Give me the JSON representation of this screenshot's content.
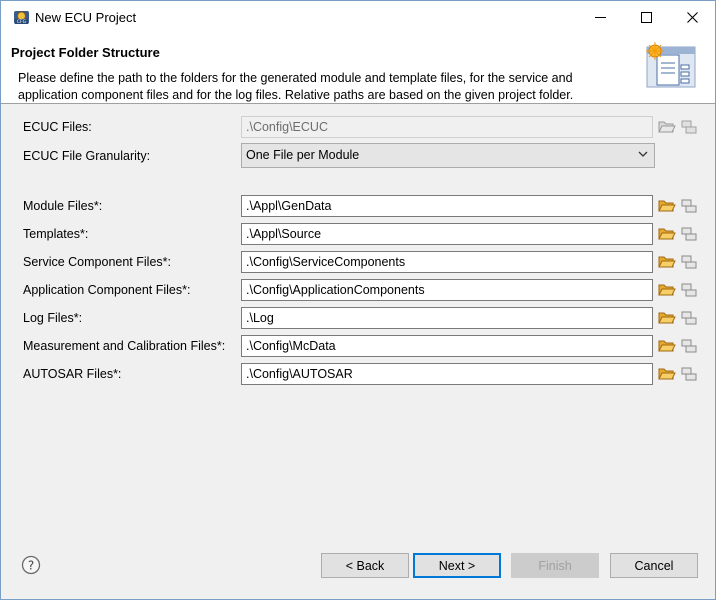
{
  "window": {
    "title": "New ECU Project"
  },
  "header": {
    "title": "Project Folder Structure",
    "description": "Please define the path to the folders for the generated module and template files, for the service and application component files and for the log files. Relative paths are based on the given project folder."
  },
  "form": {
    "ecuc_files": {
      "label": "ECUC Files:",
      "value": ".\\Config\\ECUC"
    },
    "granularity": {
      "label": "ECUC File Granularity:",
      "value": "One File per Module"
    },
    "rows": [
      {
        "label": "Module Files*:",
        "value": ".\\Appl\\GenData"
      },
      {
        "label": "Templates*:",
        "value": ".\\Appl\\Source"
      },
      {
        "label": "Service Component Files*:",
        "value": ".\\Config\\ServiceComponents"
      },
      {
        "label": "Application Component Files*:",
        "value": ".\\Config\\ApplicationComponents"
      },
      {
        "label": "Log Files*:",
        "value": ".\\Log"
      },
      {
        "label": "Measurement and Calibration Files*:",
        "value": ".\\Config\\McData"
      },
      {
        "label": "AUTOSAR Files*:",
        "value": ".\\Config\\AUTOSAR"
      }
    ]
  },
  "buttons": {
    "back": "< Back",
    "next": "Next >",
    "finish": "Finish",
    "cancel": "Cancel"
  },
  "icons": {
    "app": "eclipse-cfg-icon",
    "folder": "folder-open-icon",
    "variables": "variables-icon",
    "help": "help-icon",
    "header": "wizard-file-icon"
  },
  "colors": {
    "accent": "#0078d7",
    "folder": "#f0b848"
  }
}
